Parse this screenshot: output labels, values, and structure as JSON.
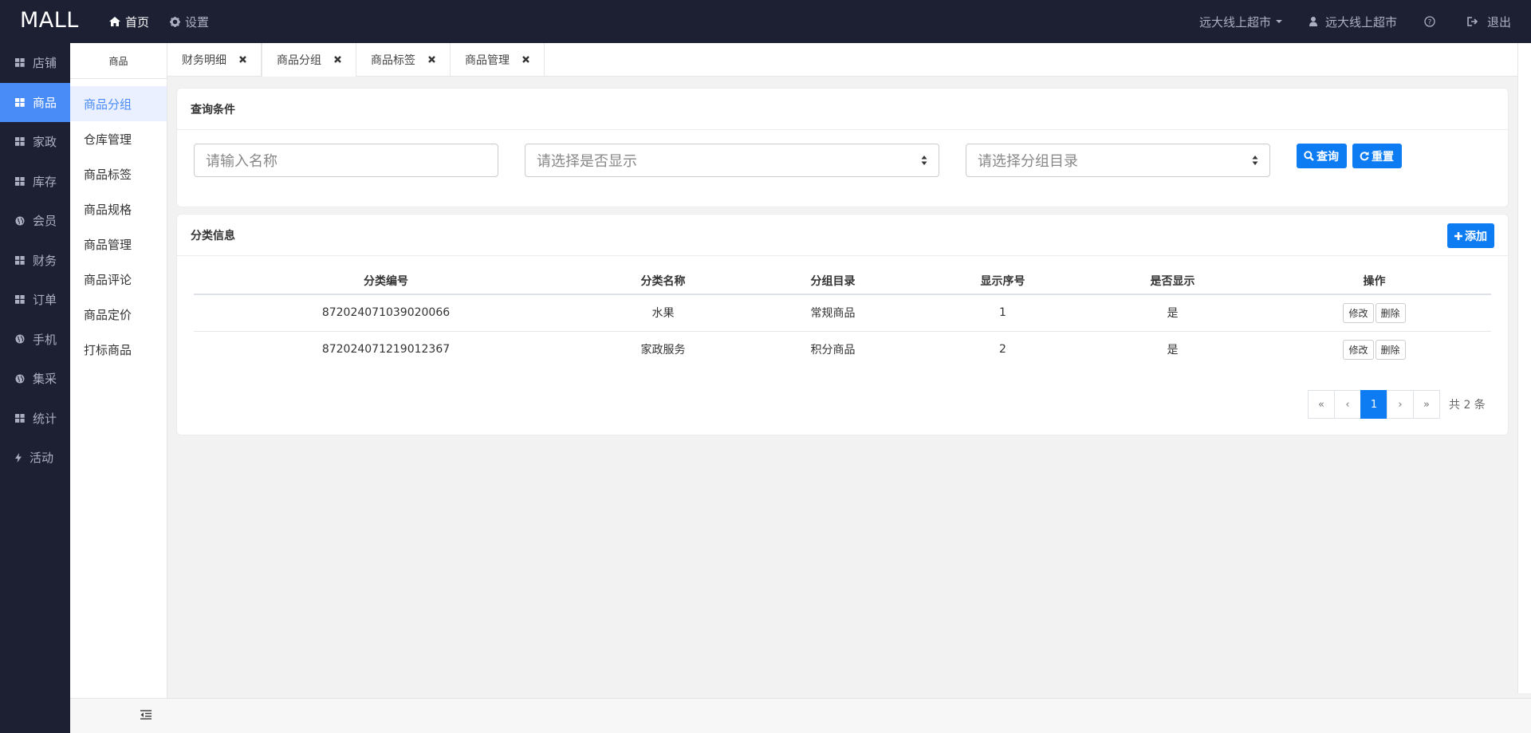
{
  "header": {
    "brand": "MALL",
    "nav": [
      {
        "label": "首页",
        "icon": "home-icon",
        "active": true
      },
      {
        "label": "设置",
        "icon": "gear-icon",
        "active": false
      }
    ],
    "store_dropdown": "远大线上超市",
    "user": "远大线上超市",
    "logout": "退出"
  },
  "sidebar": {
    "items": [
      {
        "label": "店铺",
        "icon": "grid-icon"
      },
      {
        "label": "商品",
        "icon": "grid-icon",
        "active": true
      },
      {
        "label": "家政",
        "icon": "grid-icon"
      },
      {
        "label": "库存",
        "icon": "grid-icon"
      },
      {
        "label": "会员",
        "icon": "globe-icon"
      },
      {
        "label": "财务",
        "icon": "grid-icon"
      },
      {
        "label": "订单",
        "icon": "grid-icon"
      },
      {
        "label": "手机",
        "icon": "globe-icon"
      },
      {
        "label": "集采",
        "icon": "globe-icon"
      },
      {
        "label": "统计",
        "icon": "grid-icon"
      },
      {
        "label": "活动",
        "icon": "bolt-icon"
      }
    ]
  },
  "submenu": {
    "title": "商品",
    "items": [
      "商品分组",
      "仓库管理",
      "商品标签",
      "商品规格",
      "商品管理",
      "商品评论",
      "商品定价",
      "打标商品"
    ],
    "active_index": 0
  },
  "tabs": [
    {
      "label": "财务明细"
    },
    {
      "label": "商品分组",
      "active": true
    },
    {
      "label": "商品标签"
    },
    {
      "label": "商品管理"
    }
  ],
  "query": {
    "title": "查询条件",
    "name_placeholder": "请输入名称",
    "show_select": "请选择是否显示",
    "group_select": "请选择分组目录",
    "search_label": "查询",
    "reset_label": "重置"
  },
  "info": {
    "title": "分类信息",
    "add_label": "添加",
    "columns": [
      "分类编号",
      "分类名称",
      "分组目录",
      "显示序号",
      "是否显示",
      "操作"
    ],
    "rows": [
      {
        "code": "872024071039020066",
        "name": "水果",
        "group": "常规商品",
        "order": "1",
        "show": "是",
        "edit": "修改",
        "delete": "删除"
      },
      {
        "code": "872024071219012367",
        "name": "家政服务",
        "group": "积分商品",
        "order": "2",
        "show": "是",
        "edit": "修改",
        "delete": "删除"
      }
    ]
  },
  "pagination": {
    "first": "«",
    "prev": "‹",
    "current": "1",
    "next": "›",
    "last": "»",
    "total_text": "共 2 条"
  },
  "colors": {
    "topbar_bg": "#1d2033",
    "accent": "#0d7cf2",
    "sidebar_active": "#4a8cf7"
  }
}
